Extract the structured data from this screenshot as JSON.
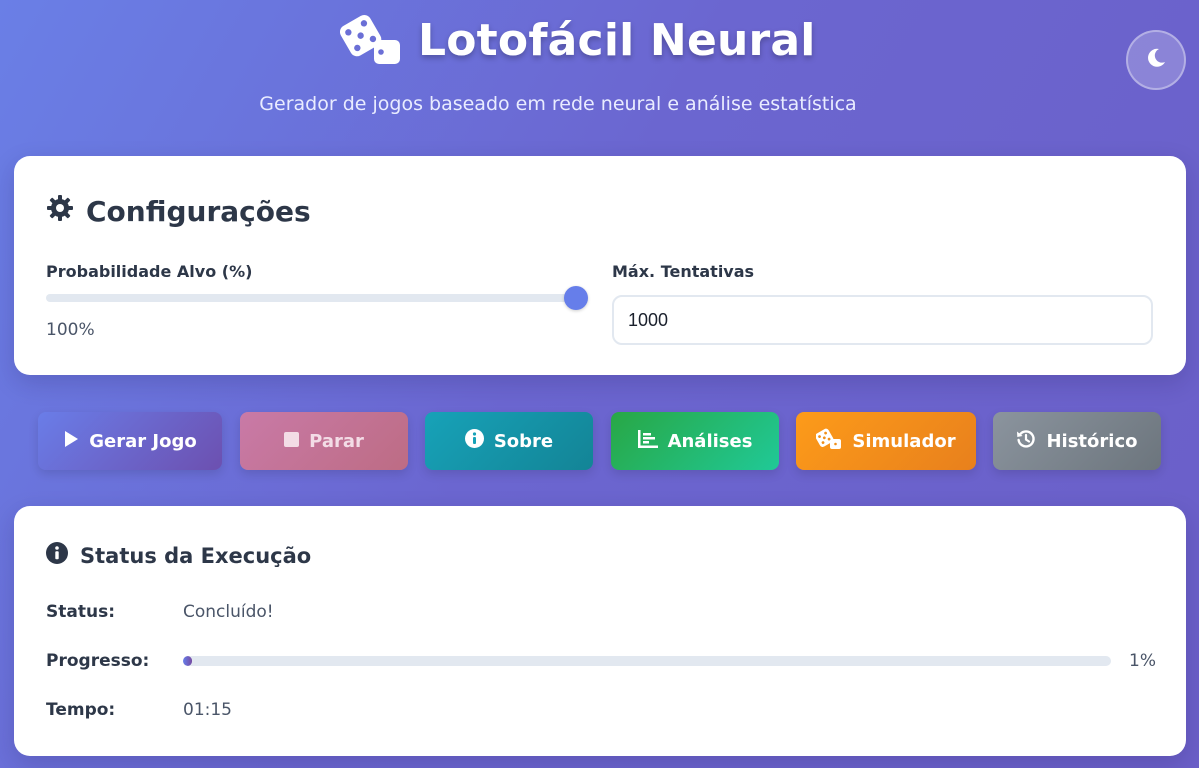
{
  "header": {
    "title": "Lotofácil Neural",
    "subtitle": "Gerador de jogos baseado em rede neural e análise estatística",
    "logo_icon": "dice-icon",
    "theme_toggle_icon": "moon-icon"
  },
  "config": {
    "title": "Configurações",
    "title_icon": "gear-icon",
    "probability": {
      "label": "Probabilidade Alvo (%)",
      "value": 100,
      "value_text": "100%"
    },
    "max_attempts": {
      "label": "Máx. Tentativas",
      "value": "1000"
    }
  },
  "actions": [
    {
      "label": "Gerar Jogo",
      "icon": "play-icon"
    },
    {
      "label": "Parar",
      "icon": "stop-icon"
    },
    {
      "label": "Sobre",
      "icon": "info-circle-icon"
    },
    {
      "label": "Análises",
      "icon": "chart-bar-icon"
    },
    {
      "label": "Simulador",
      "icon": "dice-icon"
    },
    {
      "label": "Histórico",
      "icon": "history-icon"
    }
  ],
  "status": {
    "title": "Status da Execução",
    "title_icon": "info-circle-icon",
    "status_label": "Status:",
    "status_value": "Concluído!",
    "progress_label": "Progresso:",
    "progress_value": 1,
    "progress_text": "1%",
    "time_label": "Tempo:",
    "time_value": "01:15"
  },
  "colors": {
    "accent": "#667eea",
    "gradient_end": "#764ba2",
    "sobre": "#17a2b8",
    "analises": "#28a745",
    "simulador": "#fd9b1a",
    "historico": "#6c757d"
  }
}
